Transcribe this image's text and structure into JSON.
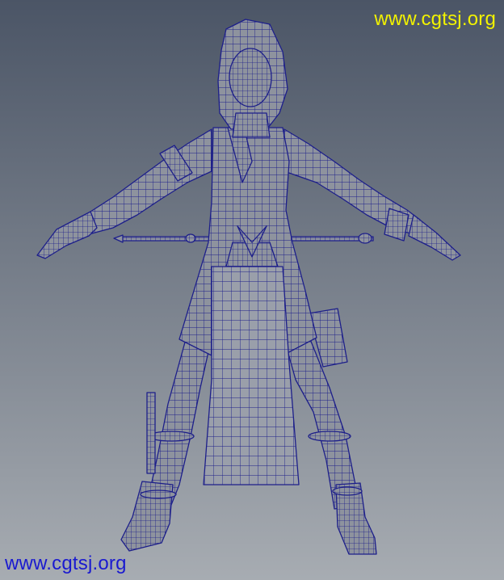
{
  "viewport": {
    "background_top": "#4b5566",
    "background_bottom": "#a7acb2",
    "mesh_fill": "#8e939e",
    "mesh_wire": "#1d1f8a"
  },
  "watermark": {
    "top_text": "www.cgtsj.org",
    "top_color": "#f2f200",
    "bottom_text": "www.cgtsj.org",
    "bottom_color": "#1a1ad0"
  },
  "model": {
    "icon": "wireframe-character-mesh"
  }
}
